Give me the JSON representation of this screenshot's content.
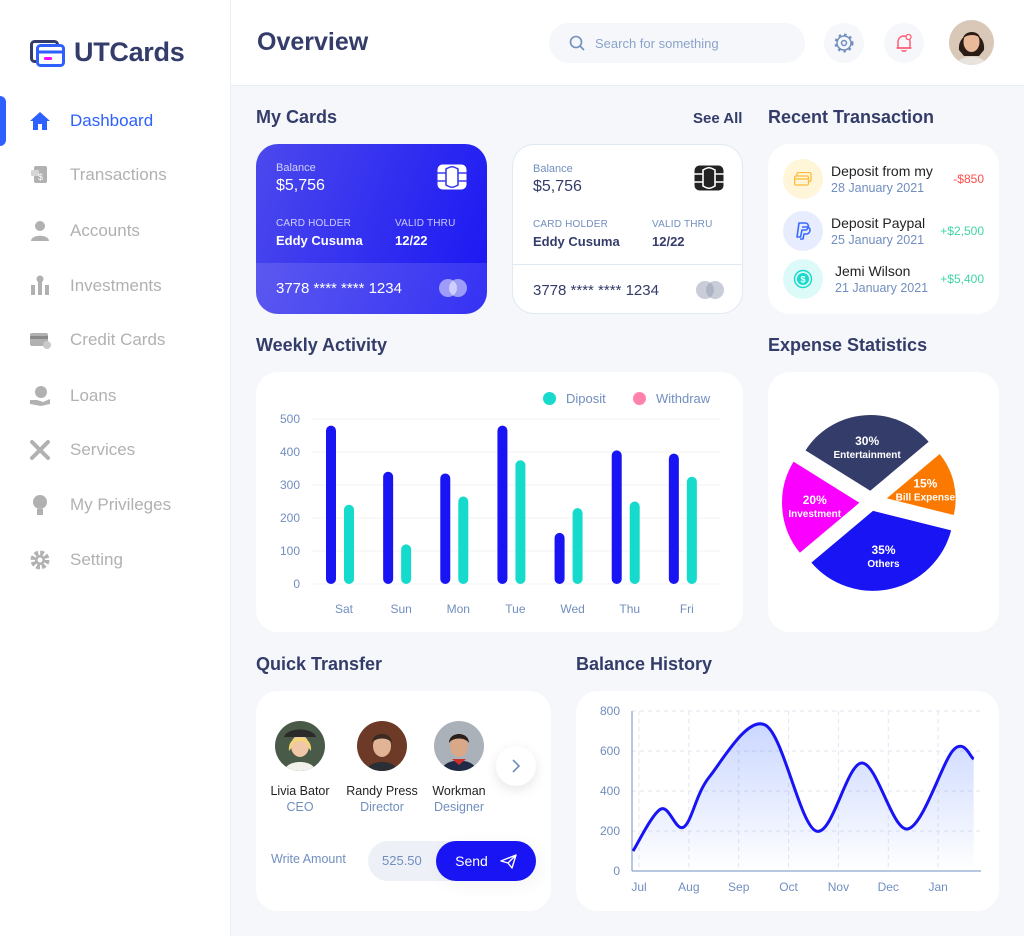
{
  "app": {
    "name": "UTCards"
  },
  "sidebar": {
    "items": [
      {
        "label": "Dashboard",
        "icon": "home-icon",
        "active": true
      },
      {
        "label": "Transactions",
        "icon": "transfer-icon"
      },
      {
        "label": "Accounts",
        "icon": "user-icon"
      },
      {
        "label": "Investments",
        "icon": "investment-icon"
      },
      {
        "label": "Credit Cards",
        "icon": "credit-card-icon"
      },
      {
        "label": "Loans",
        "icon": "loan-icon"
      },
      {
        "label": "Services",
        "icon": "service-icon"
      },
      {
        "label": "My Privileges",
        "icon": "privilege-icon"
      },
      {
        "label": "Setting",
        "icon": "settings-icon"
      }
    ]
  },
  "header": {
    "title": "Overview",
    "search_placeholder": "Search for something"
  },
  "cards_section": {
    "title": "My Cards",
    "see_all": "See All",
    "cards": [
      {
        "balance_label": "Balance",
        "balance": "$5,756",
        "holder_label": "CARD HOLDER",
        "holder": "Eddy Cusuma",
        "valid_label": "VALID THRU",
        "valid": "12/22",
        "number": "3778 **** **** 1234",
        "theme": "blue"
      },
      {
        "balance_label": "Balance",
        "balance": "$5,756",
        "holder_label": "CARD HOLDER",
        "holder": "Eddy Cusuma",
        "valid_label": "VALID THRU",
        "valid": "12/22",
        "number": "3778 **** **** 1234",
        "theme": "white"
      }
    ]
  },
  "recent_transactions": {
    "title": "Recent Transaction",
    "items": [
      {
        "title": "Deposit from my",
        "date": "28 January 2021",
        "amount": "-$850",
        "type": "negative",
        "icon": "card-icon",
        "icon_bg": "#fff5d9",
        "icon_color": "#ffbb38"
      },
      {
        "title": "Deposit Paypal",
        "date": "25 January 2021",
        "amount": "+$2,500",
        "type": "positive",
        "icon": "paypal-icon",
        "icon_bg": "#e7edff",
        "icon_color": "#396aff"
      },
      {
        "title": "Jemi Wilson",
        "date": "21 January 2021",
        "amount": "+$5,400",
        "type": "positive",
        "icon": "dollar-icon",
        "icon_bg": "#dcfaf8",
        "icon_color": "#16dbcc"
      }
    ]
  },
  "weekly_activity": {
    "title": "Weekly Activity",
    "legend": {
      "deposit": "Diposit",
      "withdraw": "Withdraw"
    },
    "colors": {
      "deposit": "#16dbcc",
      "withdraw": "#ff82ac",
      "bar_dark": "#1814f3"
    }
  },
  "expense_statistics": {
    "title": "Expense Statistics"
  },
  "quick_transfer": {
    "title": "Quick Transfer",
    "people": [
      {
        "name": "Livia Bator",
        "role": "CEO"
      },
      {
        "name": "Randy Press",
        "role": "Director"
      },
      {
        "name": "Workman",
        "role": "Designer"
      }
    ],
    "amount_label": "Write Amount",
    "amount_value": "525.50",
    "send_label": "Send"
  },
  "balance_history": {
    "title": "Balance History"
  },
  "chart_data": [
    {
      "type": "bar",
      "categories": [
        "Sat",
        "Sun",
        "Mon",
        "Tue",
        "Wed",
        "Thu",
        "Fri"
      ],
      "series": [
        {
          "name": "Withdraw",
          "values": [
            480,
            340,
            335,
            480,
            155,
            405,
            395
          ]
        },
        {
          "name": "Diposit",
          "values": [
            240,
            120,
            265,
            375,
            230,
            250,
            325
          ]
        }
      ],
      "yticks": [
        500,
        400,
        300,
        200,
        100,
        0
      ],
      "ylim": [
        0,
        500
      ]
    },
    {
      "type": "pie",
      "slices": [
        {
          "label": "Entertainment",
          "value": 30,
          "color": "#343c6a"
        },
        {
          "label": "Bill Expense",
          "value": 15,
          "color": "#fc7900"
        },
        {
          "label": "Others",
          "value": 35,
          "color": "#1814f3"
        },
        {
          "label": "Investment",
          "value": 20,
          "color": "#fa00ff"
        }
      ]
    },
    {
      "type": "area",
      "x": [
        "Jul",
        "Aug",
        "Sep",
        "Oct",
        "Nov",
        "Dec",
        "Jan"
      ],
      "y": [
        100,
        310,
        220,
        470,
        730,
        200,
        540,
        210,
        605,
        560
      ],
      "x_points": [
        0,
        0.55,
        1,
        1.5,
        2.6,
        3.6,
        4.5,
        5.4,
        6.3,
        6.7
      ],
      "yticks": [
        800,
        600,
        400,
        200,
        0
      ],
      "ylim": [
        0,
        800
      ],
      "color": "#1814f3"
    }
  ]
}
